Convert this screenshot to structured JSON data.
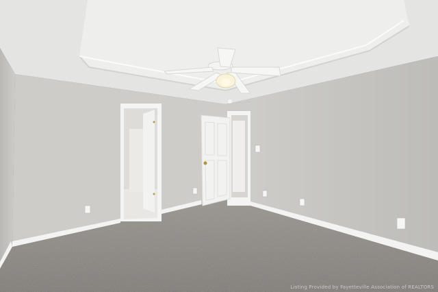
{
  "scene": {
    "description_colors": {
      "ceiling": "#e9e9e7",
      "tray": "#f1f1ef",
      "wall_left": "#c9c8c4",
      "wall_back": "#cfcecb",
      "wall_right": "#c4c3bf",
      "trim": "#f4f4f2",
      "door": "#f2f2f0",
      "carpet": "#86827e",
      "bath_tile": "#e8e7e4"
    },
    "icons": [
      "ceiling-fan-icon",
      "door-knob-icon",
      "outlet-icon",
      "light-switch-icon"
    ]
  },
  "watermark": {
    "text": "Listing Provided by Fayetteville Association of REALTORS"
  }
}
